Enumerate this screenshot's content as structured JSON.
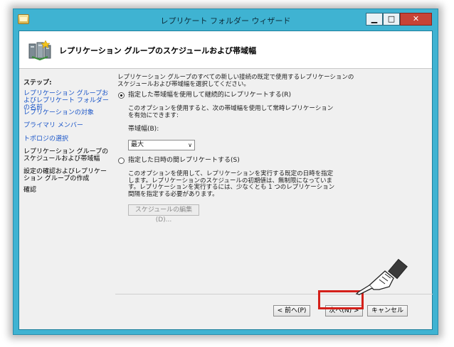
{
  "window": {
    "title": "レプリケート フォルダー ウィザード"
  },
  "header": {
    "title": "レプリケーション グループのスケジュールおよび帯域幅"
  },
  "sidebar": {
    "title": "ステップ:",
    "items": [
      {
        "label": "レプリケーション グループおよびレプリケート フォルダーの名前"
      },
      {
        "label": "レプリケーションの対象"
      },
      {
        "label": "プライマリ メンバー"
      },
      {
        "label": "トポロジの選択"
      },
      {
        "label": "レプリケーション グループのスケジュールおよび帯域幅"
      },
      {
        "label": "設定の確認およびレプリケーション グループの作成"
      },
      {
        "label": "確認"
      }
    ]
  },
  "content": {
    "intro": "レプリケーション グループのすべての新しい接続の既定で使用するレプリケーションのスケジュールおよび帯域幅を選択してください。",
    "option1": {
      "label": "指定した帯域幅を使用して継続的にレプリケートする(R)",
      "desc": "このオプションを使用すると、次の帯域幅を使用して常時レプリケーションを有効にできます:",
      "bandwidth_label": "帯域幅(B):",
      "bandwidth_value": "最大"
    },
    "option2": {
      "label": "指定した日時の間レプリケートする(S)",
      "desc": "このオプションを使用して、レプリケーションを実行する既定の日時を指定します。レプリケーションのスケジュールの初期値は、無制限になっています。レプリケーションを実行するには、少なくとも 1 つのレプリケーション間隔を指定する必要があります。",
      "edit_button": "スケジュールの編集(D)..."
    }
  },
  "footer": {
    "back": "< 前へ(P)",
    "next": "次へ(N) >",
    "cancel": "キャンセル"
  },
  "colors": {
    "frame": "#3fb3d2",
    "highlight": "#d4201a",
    "link": "#1a55c8"
  },
  "icons": {
    "app": "folder-icon",
    "header": "server-replication-icon",
    "pointer": "pointing-hand-icon"
  }
}
